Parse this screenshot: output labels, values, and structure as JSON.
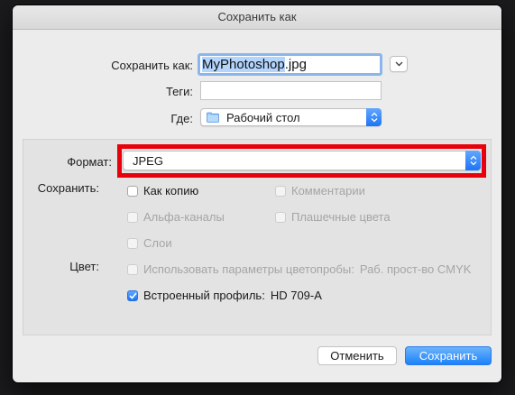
{
  "window": {
    "title": "Сохранить как"
  },
  "form": {
    "save_as_label": "Сохранить как:",
    "filename": {
      "selected": "MyPhotoshop",
      "extension": ".jpg"
    },
    "tags_label": "Теги:",
    "tags_value": "",
    "where_label": "Где:",
    "where_value": "Рабочий стол"
  },
  "options": {
    "format_label": "Формат:",
    "format_value": "JPEG",
    "save_label": "Сохранить:",
    "as_copy": {
      "label": "Как копию",
      "checked": false,
      "enabled": true
    },
    "comments": {
      "label": "Комментарии",
      "checked": false,
      "enabled": false
    },
    "alpha_channels": {
      "label": "Альфа-каналы",
      "checked": false,
      "enabled": false
    },
    "spot_colors": {
      "label": "Плашечные цвета",
      "checked": false,
      "enabled": false
    },
    "layers": {
      "label": "Слои",
      "checked": false,
      "enabled": false
    },
    "color_label": "Цвет:",
    "use_proof_setup": {
      "label": "Использовать параметры цветопробы:",
      "value": "Раб. прост-во CMYK",
      "checked": false,
      "enabled": false
    },
    "embed_profile": {
      "label": "Встроенный профиль:",
      "value": "HD 709-A",
      "checked": true,
      "enabled": true
    }
  },
  "buttons": {
    "cancel": "Отменить",
    "save": "Сохранить"
  },
  "colors": {
    "accent": "#1a82fb",
    "highlight": "#e8000b"
  },
  "icons": {
    "folder": "folder-icon",
    "expand": "chevron-down-icon",
    "stepper": "updown-stepper-icon",
    "check": "checkmark-icon"
  }
}
